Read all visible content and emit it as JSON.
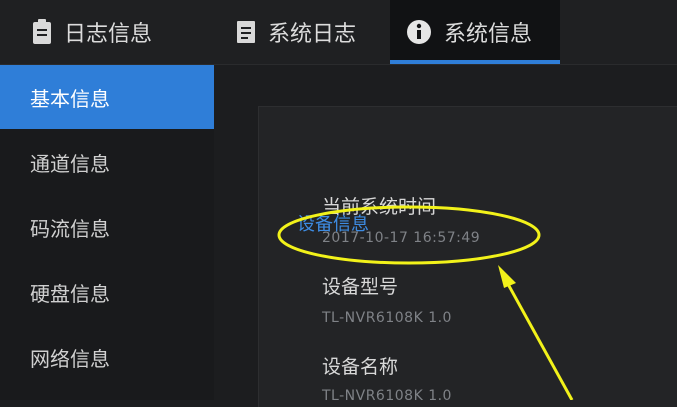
{
  "tabs": [
    {
      "label": "日志信息",
      "icon": "document-icon",
      "active": false
    },
    {
      "label": "系统日志",
      "icon": "document-icon",
      "active": false
    },
    {
      "label": "系统信息",
      "icon": "info-circle-icon",
      "active": true
    }
  ],
  "sidebar": {
    "items": [
      {
        "label": "基本信息",
        "active": true
      },
      {
        "label": "通道信息",
        "active": false
      },
      {
        "label": "码流信息",
        "active": false
      },
      {
        "label": "硬盘信息",
        "active": false
      },
      {
        "label": "网络信息",
        "active": false
      }
    ]
  },
  "device_info": {
    "section_title": "设备信息",
    "fields": [
      {
        "label": "当前系统时间",
        "value": "2017-10-17 16:57:49"
      },
      {
        "label": "设备型号",
        "value": "TL-NVR6108K 1.0"
      },
      {
        "label": "设备名称",
        "value": "TL-NVR6108K 1.0"
      }
    ]
  },
  "colors": {
    "accent": "#2f7ed8",
    "annotation": "#f2f21a"
  }
}
